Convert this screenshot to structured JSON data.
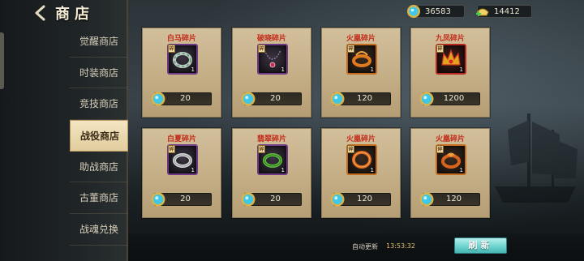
{
  "header": {
    "title": "商店"
  },
  "currency": {
    "gems": {
      "value": "36583",
      "icon": "blue-gem-icon"
    },
    "gold": {
      "value": "14412",
      "icon": "gold-ingot-plus-icon"
    }
  },
  "sidebar": {
    "items": [
      {
        "label": "觉醒商店",
        "active": false
      },
      {
        "label": "时装商店",
        "active": false
      },
      {
        "label": "竞技商店",
        "active": false
      },
      {
        "label": "战役商店",
        "active": true
      },
      {
        "label": "助战商店",
        "active": false
      },
      {
        "label": "古董商店",
        "active": false
      },
      {
        "label": "战魂兑换",
        "active": false
      }
    ]
  },
  "shop": {
    "items": [
      {
        "name": "白马碎片",
        "qty": "1",
        "price": "20",
        "icon": "jade-ring-icon",
        "frame": "purple",
        "badge": "碎"
      },
      {
        "name": "破晓碎片",
        "qty": "1",
        "price": "20",
        "icon": "necklace-icon",
        "frame": "purple",
        "badge": "碎"
      },
      {
        "name": "火凰碎片",
        "qty": "1",
        "price": "120",
        "icon": "fire-ring-icon",
        "frame": "orange",
        "badge": "碎"
      },
      {
        "name": "九凤碎片",
        "qty": "1",
        "price": "1200",
        "icon": "phoenix-crown-icon",
        "frame": "red",
        "badge": "碎"
      },
      {
        "name": "白夏碎片",
        "qty": "1",
        "price": "20",
        "icon": "silver-ring-icon",
        "frame": "purple",
        "badge": "碎"
      },
      {
        "name": "翡翠碎片",
        "qty": "1",
        "price": "20",
        "icon": "jade-bangle-icon",
        "frame": "purple",
        "badge": "碎"
      },
      {
        "name": "火凰碎片",
        "qty": "1",
        "price": "120",
        "icon": "flame-ring-icon",
        "frame": "orange",
        "badge": "碎"
      },
      {
        "name": "火凰碎片",
        "qty": "1",
        "price": "120",
        "icon": "phoenix-ring-icon",
        "frame": "orange",
        "badge": "碎"
      }
    ]
  },
  "footer": {
    "auto_refresh_label": "自动更新",
    "auto_refresh_time": "13:53:32",
    "refresh_button": "刷新"
  },
  "colors": {
    "accent_teal": "#6fd4cf",
    "item_name_red": "#c22b1a",
    "active_tab": "#f4e6c3"
  }
}
